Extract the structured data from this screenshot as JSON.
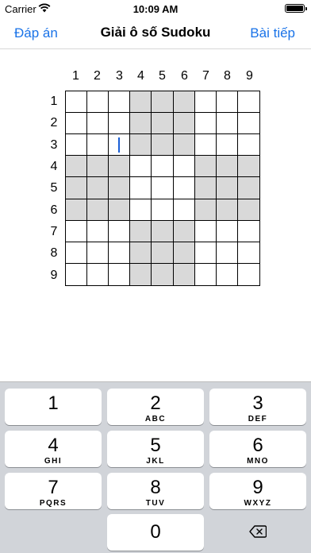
{
  "status": {
    "carrier": "Carrier",
    "time": "10:09 AM"
  },
  "nav": {
    "left_button": "Đáp án",
    "title": "Giải ô số Sudoku",
    "right_button": "Bài tiếp"
  },
  "grid": {
    "column_labels": [
      "1",
      "2",
      "3",
      "4",
      "5",
      "6",
      "7",
      "8",
      "9"
    ],
    "row_labels": [
      "1",
      "2",
      "3",
      "4",
      "5",
      "6",
      "7",
      "8",
      "9"
    ],
    "shade_color": "#d9d9d9",
    "cursor_cell": {
      "row": 3,
      "column": 3
    }
  },
  "keypad": {
    "keys": [
      {
        "digit": "1",
        "letters": ""
      },
      {
        "digit": "2",
        "letters": "ABC"
      },
      {
        "digit": "3",
        "letters": "DEF"
      },
      {
        "digit": "4",
        "letters": "GHI"
      },
      {
        "digit": "5",
        "letters": "JKL"
      },
      {
        "digit": "6",
        "letters": "MNO"
      },
      {
        "digit": "7",
        "letters": "PQRS"
      },
      {
        "digit": "8",
        "letters": "TUV"
      },
      {
        "digit": "9",
        "letters": "WXYZ"
      }
    ],
    "zero": "0",
    "delete_icon": "backspace-icon"
  },
  "accent_color": "#1a73e8"
}
